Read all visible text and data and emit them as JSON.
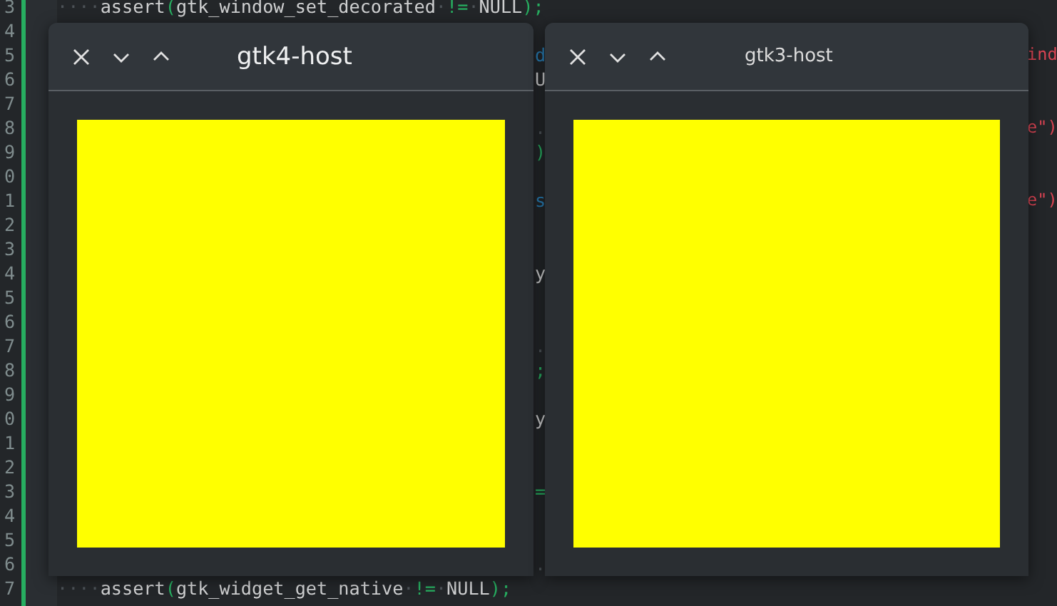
{
  "editor": {
    "lines": [
      {
        "number": "3",
        "tokens": [
          {
            "text": "····",
            "kind": "ws"
          },
          {
            "text": "assert",
            "kind": "plain"
          },
          {
            "text": "(",
            "kind": "punct"
          },
          {
            "text": "gtk_window_set_decorated",
            "kind": "plain"
          },
          {
            "text": "·",
            "kind": "ws"
          },
          {
            "text": "!=",
            "kind": "punct"
          },
          {
            "text": "·",
            "kind": "ws"
          },
          {
            "text": "NULL",
            "kind": "plain"
          },
          {
            "text": ");",
            "kind": "punct"
          }
        ]
      },
      {
        "number": "4"
      },
      {
        "number": "5",
        "gap": {
          "text": "d",
          "kind": "keyword"
        },
        "right": {
          "text": "ind",
          "kind": "string"
        }
      },
      {
        "number": "6",
        "gap": {
          "text": "U",
          "kind": "plain"
        }
      },
      {
        "number": "7"
      },
      {
        "number": "8",
        "gap": {
          "text": ".",
          "kind": "ws"
        },
        "right": {
          "text": "e\")",
          "kind": "string"
        }
      },
      {
        "number": "9",
        "gap": {
          "text": ")",
          "kind": "punct"
        }
      },
      {
        "number": "0"
      },
      {
        "number": "1",
        "gap": {
          "text": "s",
          "kind": "keyword"
        },
        "right": {
          "text": "e\")",
          "kind": "string"
        }
      },
      {
        "number": "2"
      },
      {
        "number": "3"
      },
      {
        "number": "4",
        "gap": {
          "text": "y",
          "kind": "plain"
        }
      },
      {
        "number": "5"
      },
      {
        "number": "6"
      },
      {
        "number": "7",
        "gap": {
          "text": ".",
          "kind": "ws"
        }
      },
      {
        "number": "8",
        "gap": {
          "text": ";",
          "kind": "punct"
        }
      },
      {
        "number": "9"
      },
      {
        "number": "0",
        "gap": {
          "text": "y",
          "kind": "plain"
        }
      },
      {
        "number": "1"
      },
      {
        "number": "2"
      },
      {
        "number": "3",
        "gap": {
          "text": "=",
          "kind": "punct"
        }
      },
      {
        "number": "4"
      },
      {
        "number": "5"
      },
      {
        "number": "6",
        "gap": {
          "text": ".",
          "kind": "ws"
        }
      },
      {
        "number": "7",
        "tokens": [
          {
            "text": "····",
            "kind": "ws"
          },
          {
            "text": "assert",
            "kind": "plain"
          },
          {
            "text": "(",
            "kind": "punct"
          },
          {
            "text": "gtk_widget_get_native",
            "kind": "plain"
          },
          {
            "text": "·",
            "kind": "ws"
          },
          {
            "text": "!=",
            "kind": "punct"
          },
          {
            "text": "·",
            "kind": "ws"
          },
          {
            "text": "NULL",
            "kind": "plain"
          },
          {
            "text": ");",
            "kind": "punct"
          }
        ]
      }
    ]
  },
  "windows": [
    {
      "title": "gtk4-host",
      "kind": "large-title"
    },
    {
      "title": "gtk3-host",
      "kind": "small-title"
    }
  ]
}
